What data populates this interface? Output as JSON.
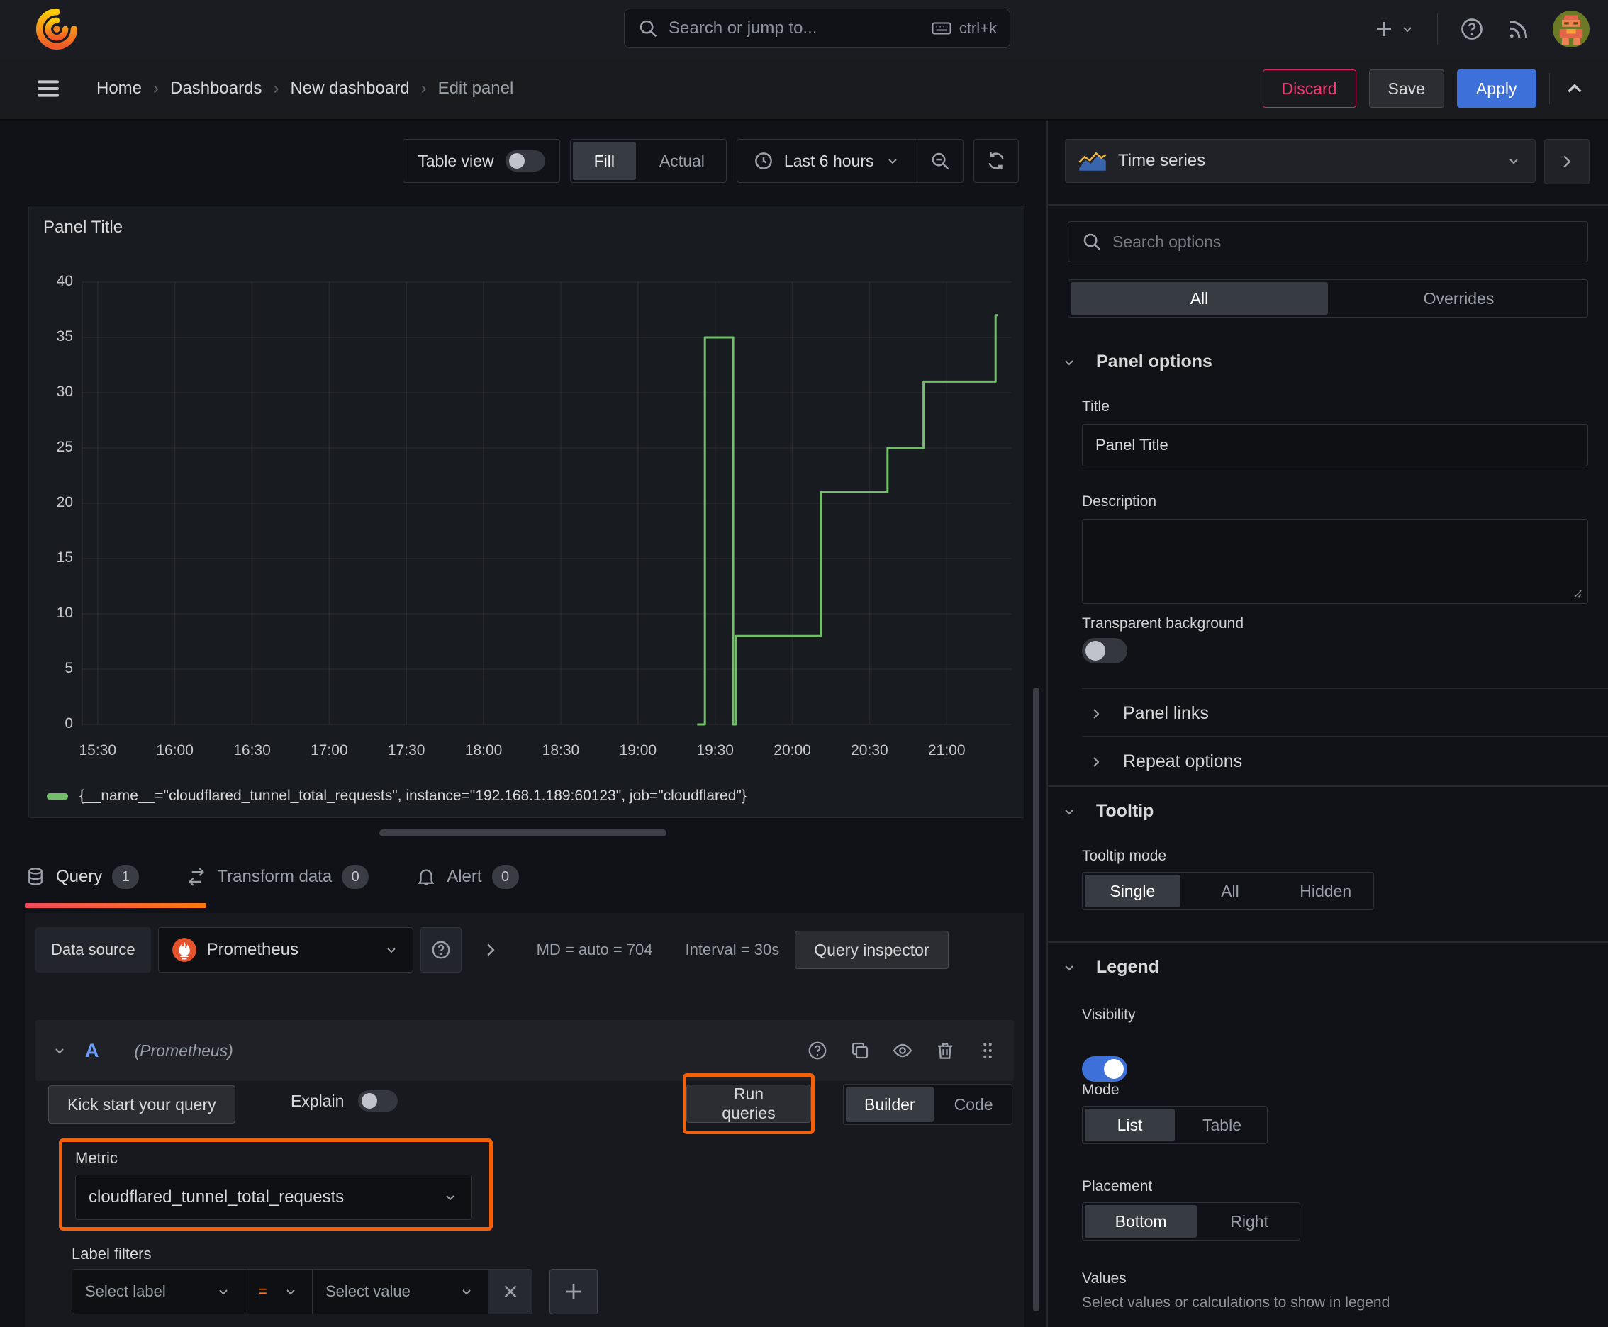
{
  "colors": {
    "accent_orange": "#f2600c",
    "tab_gradient": [
      "#f2495c",
      "#ff780a"
    ],
    "primary_blue": "#3d71d9",
    "danger_pink": "#e0226e",
    "series_green": "#73bf69",
    "background": "#111217",
    "panel_background": "#181b20"
  },
  "topnav": {
    "search_placeholder": "Search or jump to...",
    "shortcut": "ctrl+k"
  },
  "breadcrumb": {
    "items": [
      "Home",
      "Dashboards",
      "New dashboard",
      "Edit panel"
    ],
    "discard": "Discard",
    "save": "Save",
    "apply": "Apply"
  },
  "toolbar": {
    "table_view": "Table view",
    "fill": "Fill",
    "actual": "Actual",
    "time_range": "Last 6 hours"
  },
  "panel": {
    "title": "Panel Title"
  },
  "chart_data": {
    "type": "line",
    "step": true,
    "title": "Panel Title",
    "xlabel": "",
    "ylabel": "",
    "grid": true,
    "legend_position": "bottom",
    "x_domain": [
      0,
      361
    ],
    "y_domain": [
      0,
      40
    ],
    "y_ticks": [
      0,
      5,
      10,
      15,
      20,
      25,
      30,
      35,
      40
    ],
    "x_ticks": [
      {
        "t": 6,
        "label": "15:30"
      },
      {
        "t": 36,
        "label": "16:00"
      },
      {
        "t": 66,
        "label": "16:30"
      },
      {
        "t": 96,
        "label": "17:00"
      },
      {
        "t": 126,
        "label": "17:30"
      },
      {
        "t": 156,
        "label": "18:00"
      },
      {
        "t": 186,
        "label": "18:30"
      },
      {
        "t": 216,
        "label": "19:00"
      },
      {
        "t": 246,
        "label": "19:30"
      },
      {
        "t": 276,
        "label": "20:00"
      },
      {
        "t": 306,
        "label": "20:30"
      },
      {
        "t": 336,
        "label": "21:00"
      }
    ],
    "series": [
      {
        "name": "{__name__=\"cloudflared_tunnel_total_requests\", instance=\"192.168.1.189:60123\", job=\"cloudflared\"}",
        "color": "#73bf69",
        "points": [
          [
            239,
            0
          ],
          [
            242,
            0
          ],
          [
            242,
            35
          ],
          [
            253,
            35
          ],
          [
            253,
            0
          ],
          [
            254,
            0
          ],
          [
            254,
            8
          ],
          [
            287,
            8
          ],
          [
            287,
            21
          ],
          [
            313,
            21
          ],
          [
            313,
            25
          ],
          [
            327,
            25
          ],
          [
            327,
            31
          ],
          [
            355,
            31
          ],
          [
            355,
            37
          ],
          [
            356,
            37
          ]
        ]
      }
    ]
  },
  "tabs": {
    "query": "Query",
    "query_count": "1",
    "transform": "Transform data",
    "transform_count": "0",
    "alert": "Alert",
    "alert_count": "0"
  },
  "datasource": {
    "label": "Data source",
    "name": "Prometheus",
    "md_text": "MD = auto = 704",
    "interval_text": "Interval = 30s",
    "inspector": "Query inspector"
  },
  "query": {
    "ref": "A",
    "ds_hint": "(Prometheus)",
    "kickstart": "Kick start your query",
    "explain": "Explain",
    "run": "Run queries",
    "builder": "Builder",
    "code": "Code"
  },
  "metric": {
    "label": "Metric",
    "value": "cloudflared_tunnel_total_requests"
  },
  "label_filters": {
    "label": "Label filters",
    "select_label": "Select label",
    "operator": "=",
    "select_value": "Select value"
  },
  "sidebar": {
    "visualization": "Time series",
    "search_placeholder": "Search options",
    "tabs": {
      "all": "All",
      "overrides": "Overrides"
    },
    "panel_options": {
      "header": "Panel options",
      "title_label": "Title",
      "title_value": "Panel Title",
      "description_label": "Description",
      "transparent_label": "Transparent background"
    },
    "panel_links": "Panel links",
    "repeat_options": "Repeat options",
    "tooltip": {
      "header": "Tooltip",
      "mode_label": "Tooltip mode",
      "options": [
        "Single",
        "All",
        "Hidden"
      ]
    },
    "legend": {
      "header": "Legend",
      "visibility_label": "Visibility",
      "mode_label": "Mode",
      "mode_options": [
        "List",
        "Table"
      ],
      "placement_label": "Placement",
      "placement_options": [
        "Bottom",
        "Right"
      ],
      "values_label": "Values",
      "values_hint": "Select values or calculations to show in legend"
    }
  }
}
